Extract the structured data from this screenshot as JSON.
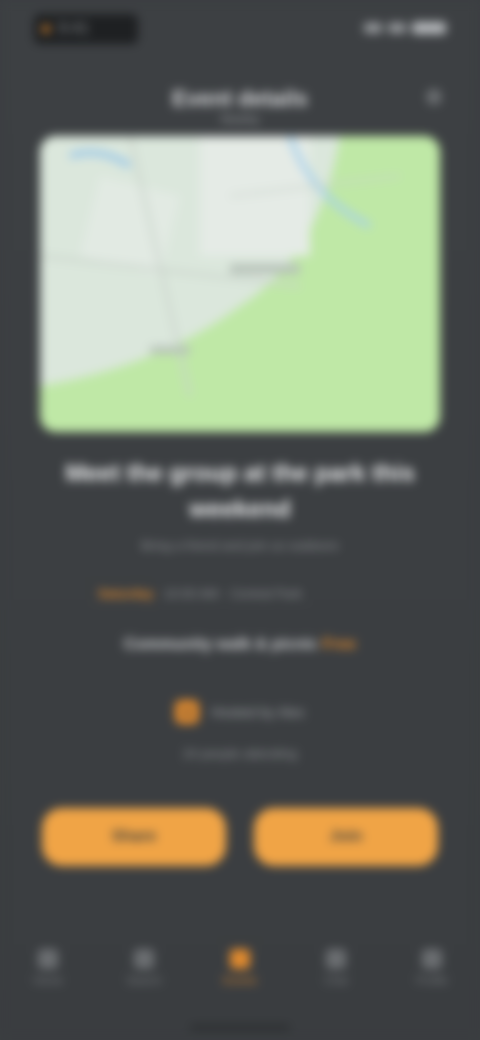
{
  "status": {
    "time": "9:41"
  },
  "header": {
    "title": "Event details",
    "subtitle": "Nearby"
  },
  "event": {
    "title": "Meet the group at the park this weekend",
    "description": "Bring a friend and join us outdoors",
    "tag": "Saturday",
    "meta_text": "10:00 AM · Central Park",
    "summary_prefix": "Community walk & picnic",
    "summary_accent": "Free",
    "organizer": "Hosted by Alex",
    "attendees": "24 people attending"
  },
  "buttons": {
    "left": "Share",
    "right": "Join"
  },
  "nav": {
    "items": [
      {
        "label": "Home"
      },
      {
        "label": "Search"
      },
      {
        "label": "Events"
      },
      {
        "label": "Chat"
      },
      {
        "label": "Profile"
      }
    ]
  },
  "colors": {
    "accent": "#e08a2e",
    "background": "#3b3e41",
    "map_green": "#bfe8a6"
  }
}
